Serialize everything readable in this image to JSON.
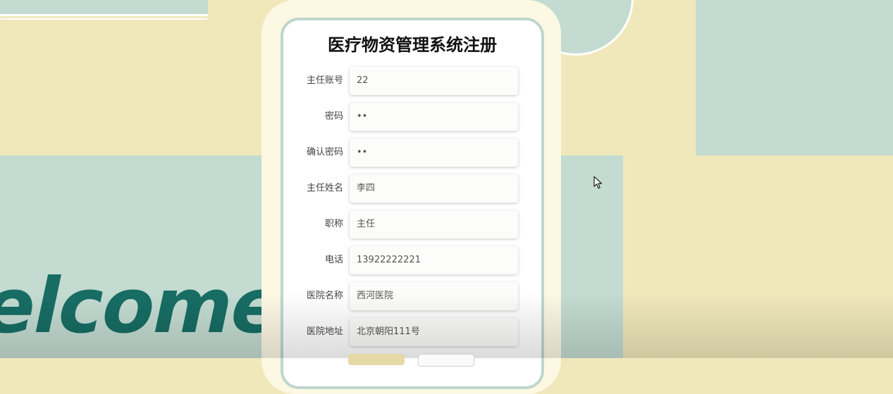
{
  "form": {
    "title": "医疗物资管理系统注册",
    "fields": [
      {
        "label": "主任账号",
        "value": "22"
      },
      {
        "label": "密码",
        "value": "••"
      },
      {
        "label": "确认密码",
        "value": "••"
      },
      {
        "label": "主任姓名",
        "value": "李四"
      },
      {
        "label": "职称",
        "value": "主任"
      },
      {
        "label": "电话",
        "value": "13922222221"
      },
      {
        "label": "医院名称",
        "value": "西河医院"
      },
      {
        "label": "医院地址",
        "value": "北京朝阳111号"
      }
    ]
  },
  "background": {
    "welcome_text": "elcome"
  },
  "colors": {
    "page_bg": "#f0e8bb",
    "teal_block": "#c3dbd1",
    "welcome_text": "#176d64",
    "card_outer": "#fdf8e4",
    "card_border": "#bfd6cd"
  },
  "icons": {
    "cursor": "mouse-pointer-icon"
  }
}
